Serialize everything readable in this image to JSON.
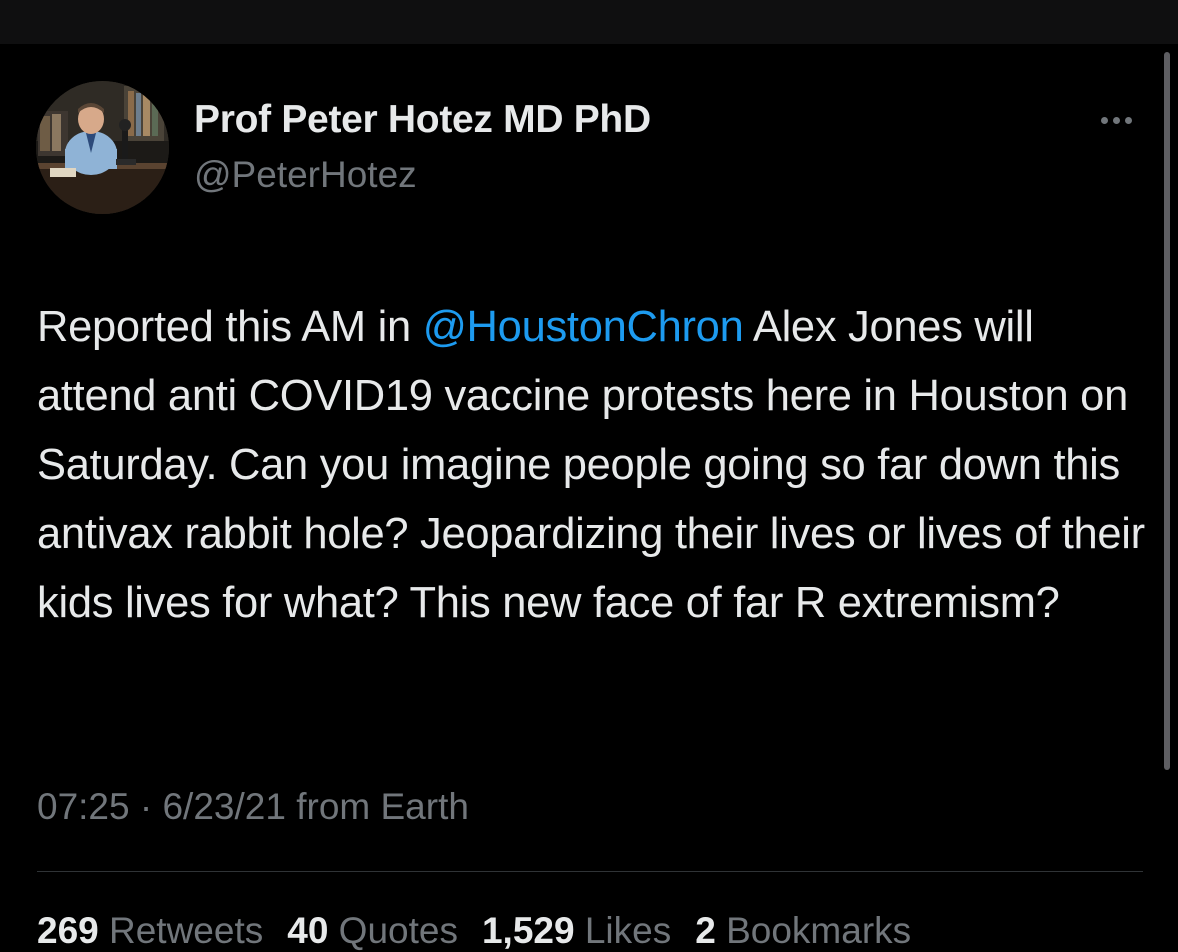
{
  "tweet": {
    "author": {
      "display_name": "Prof Peter Hotez MD PhD",
      "handle": "@PeterHotez"
    },
    "more_icon": "more-horizontal-icon",
    "text": {
      "part1": "Reported this AM in ",
      "mention": "@HoustonChron",
      "part2": " Alex Jones will attend anti COVID19 vaccine protests here in Houston on Saturday. Can you imagine people going so far down this antivax rabbit hole? Jeopardizing their lives or lives of their kids lives for what? This new face of far R extremism?"
    },
    "meta": {
      "time": "07:25",
      "separator": " · ",
      "date": "6/23/21",
      "source": " from Earth"
    },
    "stats": {
      "retweets_count": "269",
      "retweets_label": " Retweets",
      "quotes_count": "40",
      "quotes_label": " Quotes",
      "likes_count": "1,529",
      "likes_label": " Likes",
      "bookmarks_count": "2",
      "bookmarks_label": " Bookmarks"
    }
  },
  "colors": {
    "background": "#000000",
    "text": "#e7e9ea",
    "secondary": "#71767b",
    "link": "#1d9bf0",
    "divider": "#2f3336"
  }
}
